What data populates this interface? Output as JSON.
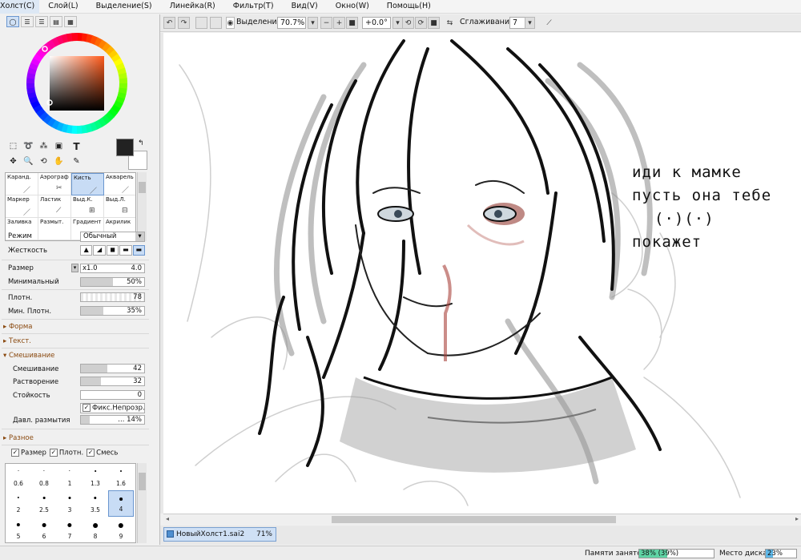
{
  "menu": [
    "Холст(C)",
    "Слой(L)",
    "Выделение(S)",
    "Линейка(R)",
    "Фильтр(T)",
    "Вид(V)",
    "Окно(W)",
    "Помощь(H)"
  ],
  "toolbar": {
    "selection_label": "Выделение",
    "zoom": "70.7%",
    "angle": "+0.0°",
    "smoothing_label": "Сглаживание",
    "smoothing_value": "7"
  },
  "tools_row1": [
    "rect-select",
    "lasso",
    "magic-wand",
    "move-layer",
    "text"
  ],
  "tools_row1_glyphs": [
    "⬚",
    "➰",
    "⁂",
    "▣",
    "T"
  ],
  "tools_row2_glyphs": [
    "✥",
    "🔍",
    "⟲",
    "✋",
    "✎"
  ],
  "brushes": [
    {
      "label": "Каранд.",
      "icon": "pencil-icon"
    },
    {
      "label": "Аэрограф",
      "icon": "airbrush-icon"
    },
    {
      "label": "Кисть",
      "icon": "brush-icon",
      "selected": true
    },
    {
      "label": "Акварель",
      "icon": "watercolor-icon"
    },
    {
      "label": "Маркер",
      "icon": "marker-icon"
    },
    {
      "label": "Ластик",
      "icon": "eraser-icon"
    },
    {
      "label": "Выд.К.",
      "icon": "select-pen-icon"
    },
    {
      "label": "Выд.Л.",
      "icon": "select-eraser-icon"
    },
    {
      "label": "Заливка",
      "icon": "bucket-icon"
    },
    {
      "label": "Размыт.",
      "icon": "blur-icon"
    },
    {
      "label": "Градиент",
      "icon": "gradient-icon"
    },
    {
      "label": "Акрилик",
      "icon": "acrylic-icon"
    }
  ],
  "props": {
    "mode_label": "Режим",
    "mode_value": "Обычный",
    "hardness_label": "Жесткость",
    "size_label": "Размер",
    "size_mult": "x1.0",
    "size_value": "4.0",
    "min_label": "Минимальный",
    "min_value": "50%",
    "min_fraction": 0.5,
    "density_label": "Плотн.",
    "density_value": "78",
    "min_density_label": "Мин. Плотн.",
    "min_density_value": "35%",
    "min_density_fraction": 0.35,
    "form_label": "Форма",
    "texture_label": "Текст.",
    "blending_label": "Смешивание",
    "blend_label": "Смешивание",
    "blend_value": "42",
    "blend_fraction": 0.42,
    "dilution_label": "Растворение",
    "dilution_value": "32",
    "dilution_fraction": 0.32,
    "persistence_label": "Стойкость",
    "persistence_value": "0",
    "keep_opacity_label": "Фикс.Непрозр.",
    "blur_pressure_label": "Давл. размытия",
    "blur_pressure_value": "... 14%",
    "blur_pressure_fraction": 0.14,
    "misc_label": "Разное",
    "chk_size": "Размер",
    "chk_density": "Плотн.",
    "chk_blend": "Смесь"
  },
  "size_grid": [
    [
      "0.6",
      "0.8",
      "1",
      "1.3",
      "1.6"
    ],
    [
      "2",
      "2.5",
      "3",
      "3.5",
      "4"
    ],
    [
      "5",
      "6",
      "7",
      "8",
      "9"
    ]
  ],
  "canvas_text": [
    "иди к мамке",
    "пусть она тебе",
    "(·)(·)",
    "покажет"
  ],
  "document": {
    "name": "НовыйХолст1.sai2",
    "zoom": "71%"
  },
  "status": {
    "memory_label": "Памяти занято",
    "memory_value": "38% (39%)",
    "memory_fraction": 0.38,
    "disk_label": "Место диска",
    "disk_value": "23%",
    "disk_fraction": 0.23
  },
  "colors": {
    "primary": "#222222",
    "secondary": "#ffffff",
    "accent": "#6a96cf"
  }
}
